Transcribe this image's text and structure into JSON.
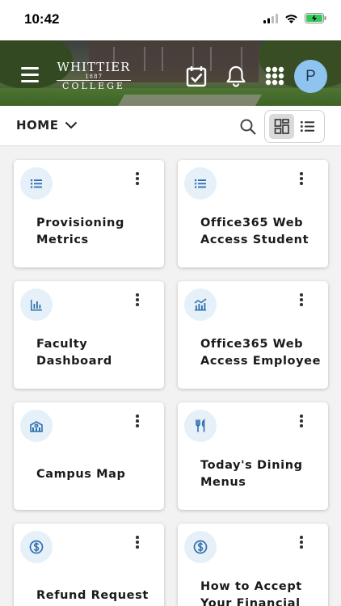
{
  "status_bar": {
    "time": "10:42"
  },
  "header": {
    "logo": {
      "line1": "WHITTIER",
      "line2": "1887",
      "line3": "COLLEGE"
    },
    "avatar_initial": "P"
  },
  "toolbar": {
    "section_label": "HOME"
  },
  "colors": {
    "icon_blue": "#2f6fae",
    "icon_bg": "#e6f0f8",
    "avatar_bg": "#90c4f0"
  },
  "cards": [
    {
      "title": "Provisioning Metrics",
      "icon": "list-icon"
    },
    {
      "title": "Office365 Web Access Student",
      "icon": "list-icon"
    },
    {
      "title": "Faculty Dashboard",
      "icon": "bar-chart-icon"
    },
    {
      "title": "Office365 Web Access Employee",
      "icon": "bar-chart-line-icon"
    },
    {
      "title": "Campus Map",
      "icon": "campus-building-icon"
    },
    {
      "title": "Today's Dining Menus",
      "icon": "fork-knife-icon"
    },
    {
      "title": "Refund Request",
      "icon": "dollar-icon"
    },
    {
      "title": "How to Accept Your Financial",
      "icon": "dollar-icon"
    }
  ]
}
